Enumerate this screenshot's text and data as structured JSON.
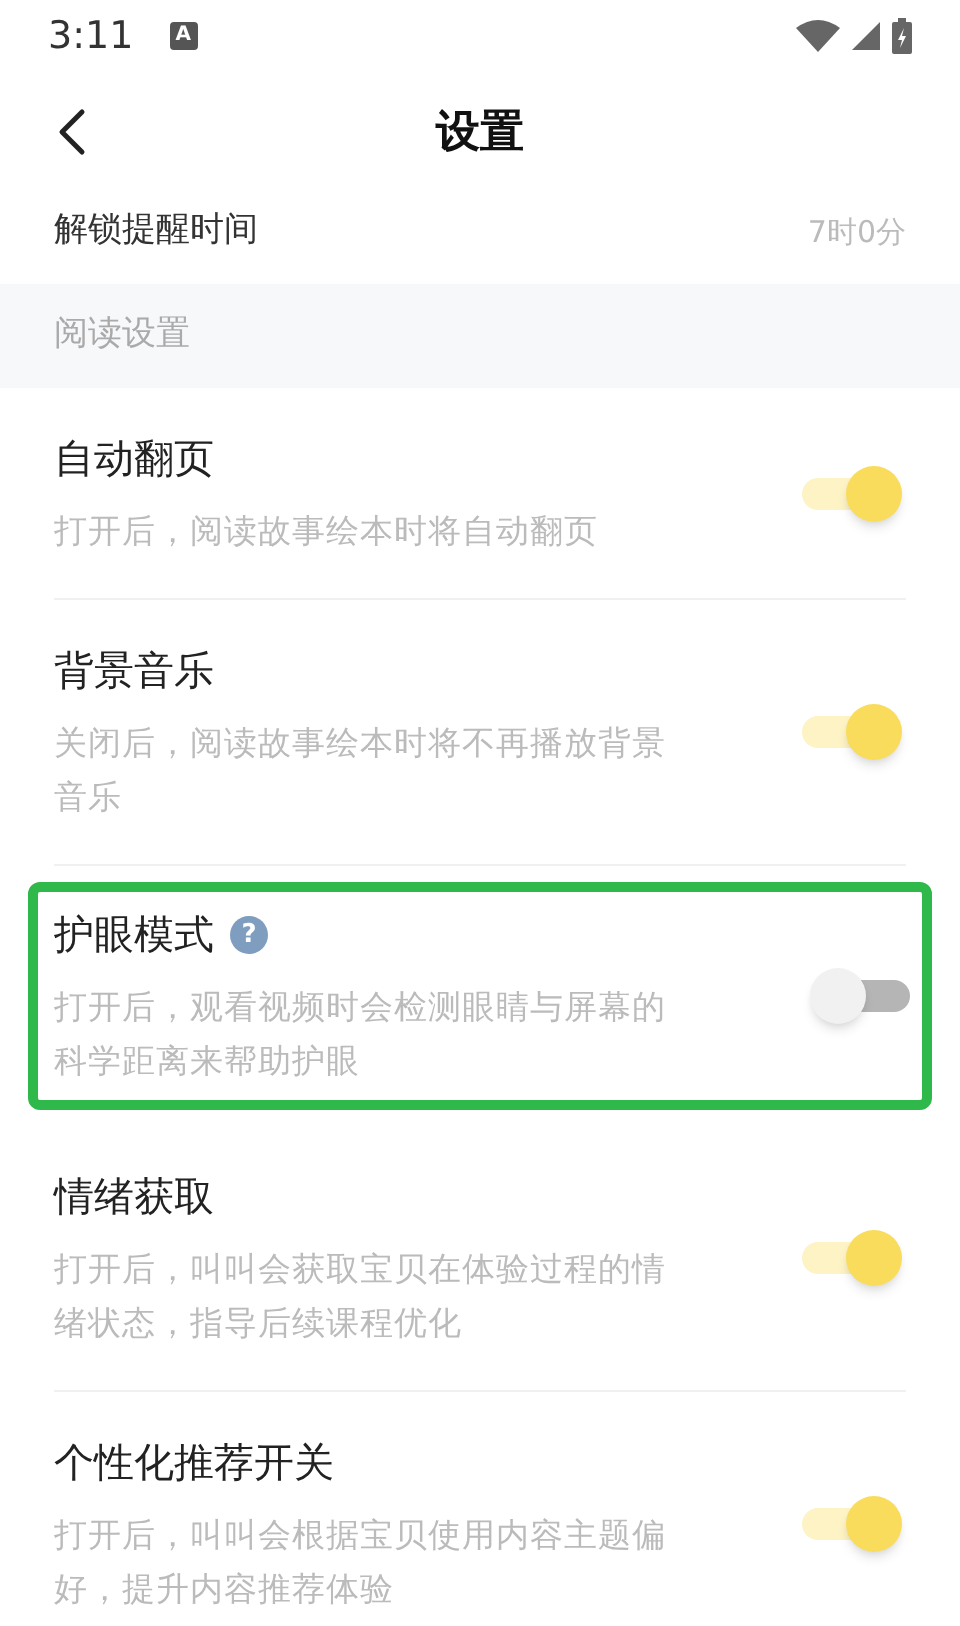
{
  "status_bar": {
    "time": "3:11",
    "notification": "A"
  },
  "header": {
    "title": "设置"
  },
  "partial_row": {
    "label": "解锁提醒时间",
    "value": "7时0分"
  },
  "section": {
    "title": "阅读设置"
  },
  "items": [
    {
      "title": "自动翻页",
      "description": "打开后，阅读故事绘本时将自动翻页",
      "on": true,
      "highlighted": false
    },
    {
      "title": "背景音乐",
      "description": "关闭后，阅读故事绘本时将不再播放背景音乐",
      "on": true,
      "highlighted": false
    },
    {
      "title": "护眼模式",
      "help": "?",
      "description": "打开后，观看视频时会检测眼睛与屏幕的科学距离来帮助护眼",
      "on": false,
      "highlighted": true
    },
    {
      "title": "情绪获取",
      "description": "打开后，叫叫会获取宝贝在体验过程的情绪状态，指导后续课程优化",
      "on": true,
      "highlighted": false
    },
    {
      "title": "个性化推荐开关",
      "description": "打开后，叫叫会根据宝贝使用内容主题偏好，提升内容推荐体验",
      "on": true,
      "highlighted": false
    }
  ]
}
